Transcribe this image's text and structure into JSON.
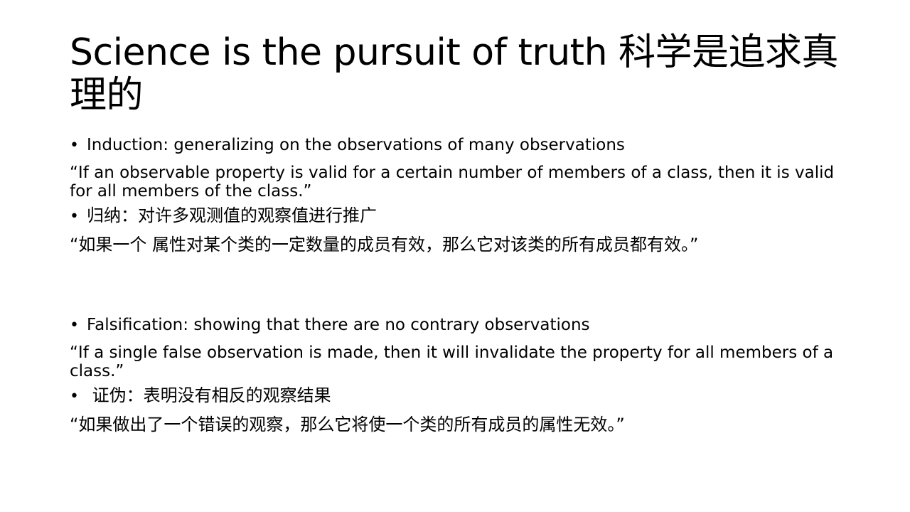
{
  "slide": {
    "title": "Science is the pursuit of truth 科学是追求真理的",
    "bullet_char": "•",
    "sections": [
      {
        "bullet_en": "Induction: generalizing on the observations of many observations",
        "quote_en": "“If an observable property is valid for a certain number of members of a class, then it is valid for all members of the class.”",
        "bullet_zh": "归纳：对许多观测值的观察值进行推广",
        "quote_zh": "“如果一个 属性对某个类的一定数量的成员有效，那么它对该类的所有成员都有效。”"
      },
      {
        "bullet_en": "Falsification: showing that there are no contrary observations",
        "quote_en": "“If a single false observation is made, then it will invalidate the property for all members of a class.”",
        "bullet_zh": " 证伪：表明没有相反的观察结果",
        "quote_zh": "“如果做出了一个错误的观察，那么它将使一个类的所有成员的属性无效。”"
      }
    ]
  }
}
